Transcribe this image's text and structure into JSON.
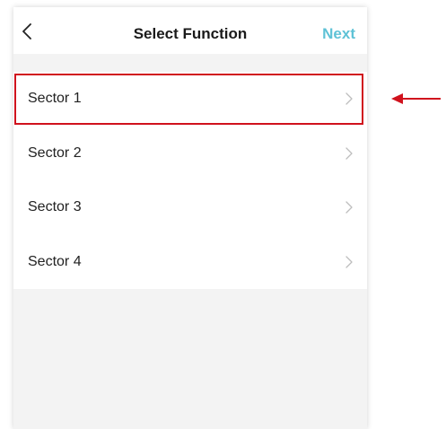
{
  "header": {
    "title": "Select Function",
    "next_label": "Next",
    "back_icon": "chevron-left-icon"
  },
  "list": {
    "items": [
      {
        "label": "Sector 1",
        "icon": "chevron-right-icon"
      },
      {
        "label": "Sector 2",
        "icon": "chevron-right-icon"
      },
      {
        "label": "Sector 3",
        "icon": "chevron-right-icon"
      },
      {
        "label": "Sector 4",
        "icon": "chevron-right-icon"
      }
    ]
  },
  "colors": {
    "accent": "#5ec2d6",
    "highlight": "#d0121d",
    "background": "#f3f3f3"
  }
}
